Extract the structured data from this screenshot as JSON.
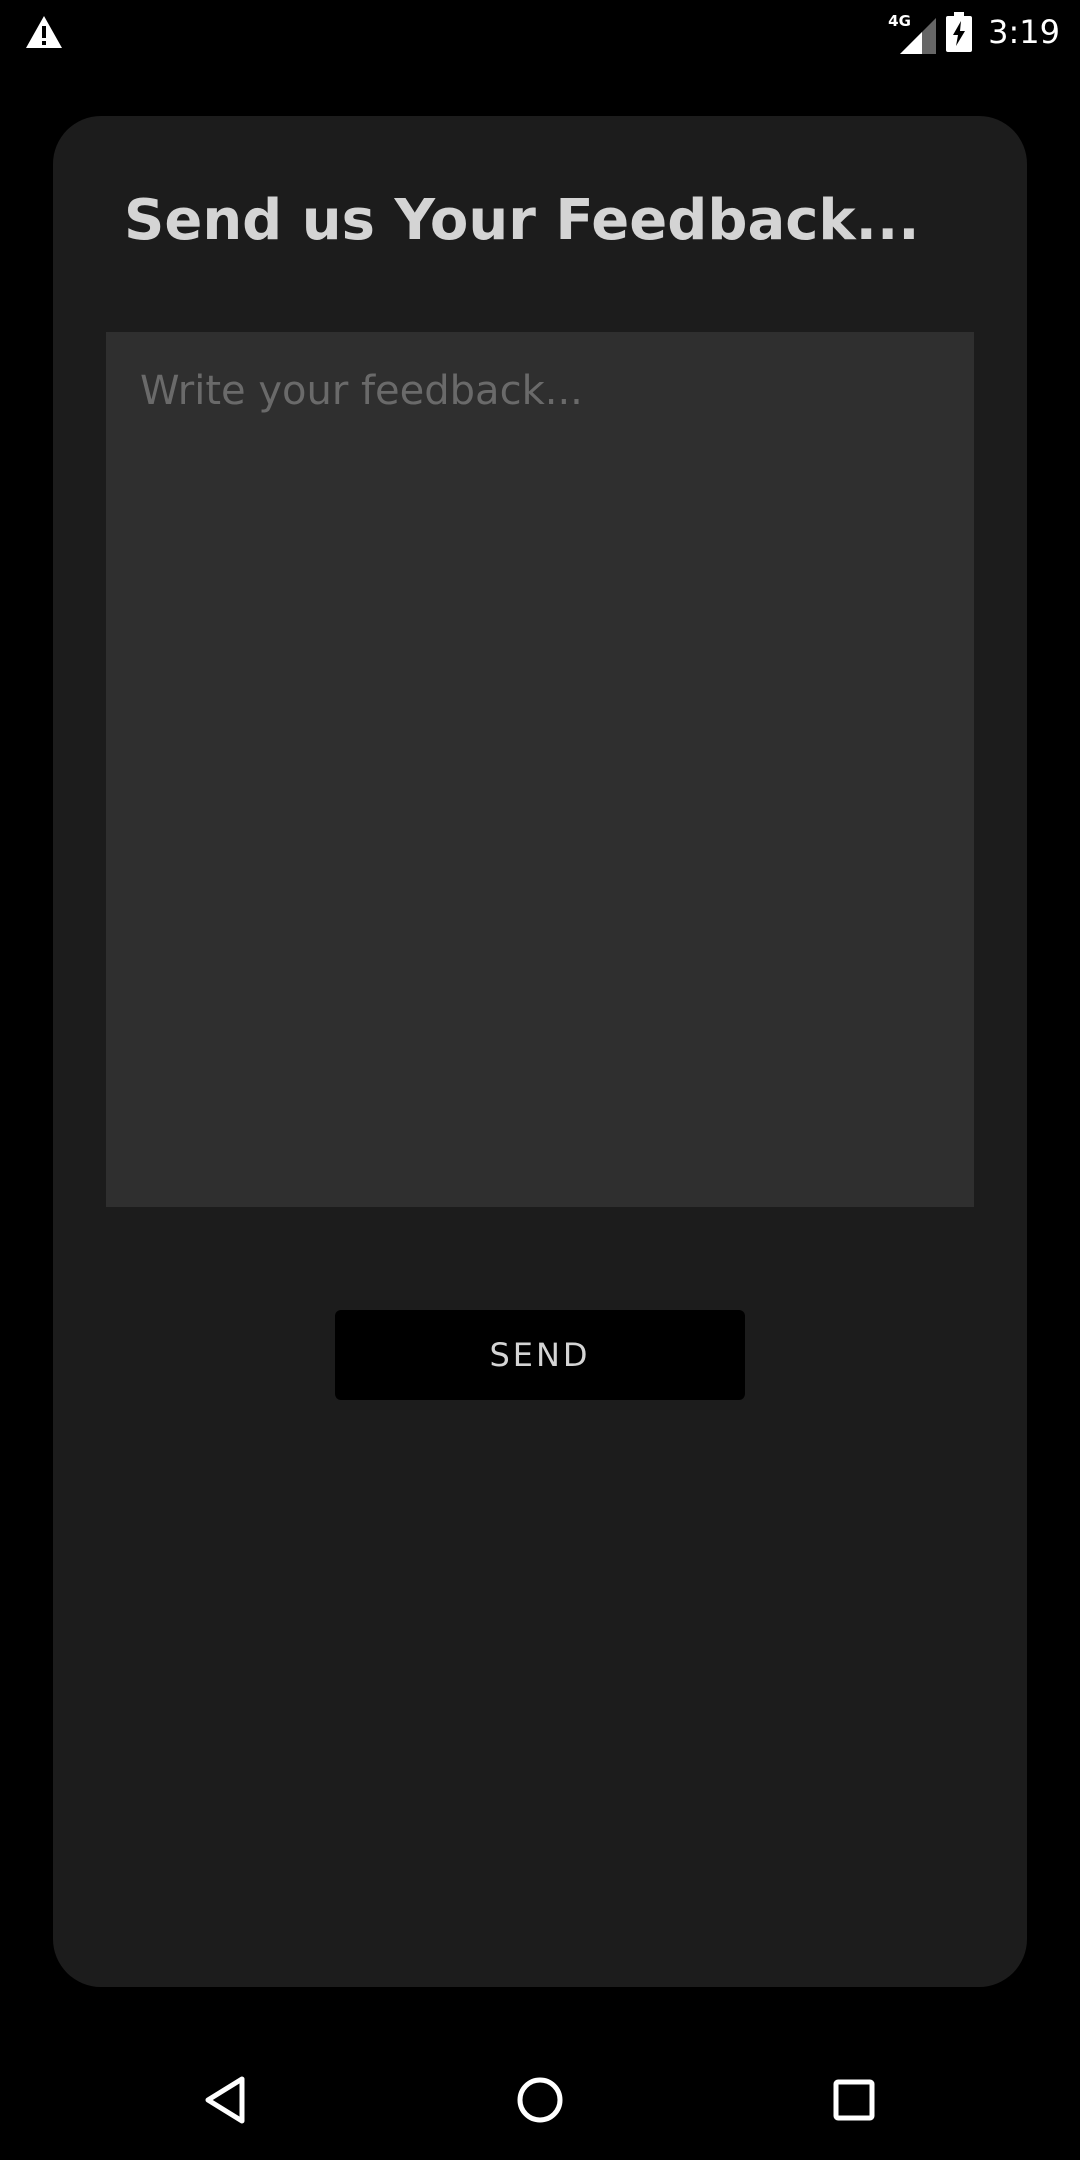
{
  "status_bar": {
    "alert_icon": "warning-icon",
    "network_type": "4G",
    "signal_icon": "cellular-signal-icon",
    "battery_icon": "battery-charging-icon",
    "time": "3:19"
  },
  "feedback": {
    "title": "Send us Your Feedback...",
    "input_value": "",
    "input_placeholder": "Write your feedback...",
    "send_label": "SEND"
  },
  "nav_bar": {
    "back_icon": "back-triangle-icon",
    "home_icon": "home-circle-icon",
    "recents_icon": "recents-square-icon"
  },
  "colors": {
    "background": "#000000",
    "card": "#1c1c1c",
    "input": "#2f2f2f",
    "title_text": "#d4d4d4",
    "placeholder_text": "#6a6a6a",
    "button": "#000000"
  }
}
